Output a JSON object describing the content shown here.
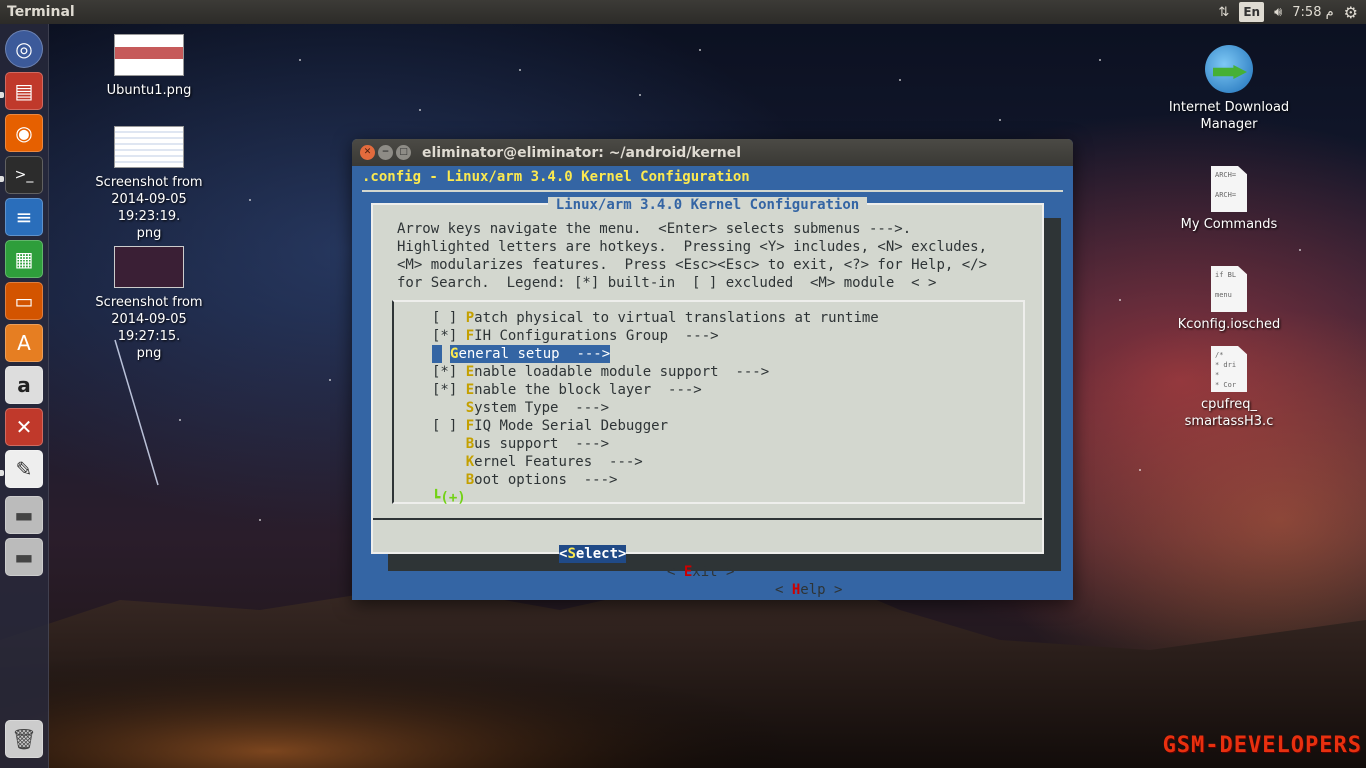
{
  "top_panel": {
    "app_title": "Terminal",
    "lang": "En",
    "clock": "7:58 م"
  },
  "launcher": {
    "items": [
      "ubuntu-dash",
      "files",
      "firefox",
      "terminal",
      "writer",
      "calc",
      "impress",
      "software-center",
      "amazon",
      "settings",
      "text-editor",
      "drive",
      "drive",
      "trash"
    ]
  },
  "desktop_icons": {
    "ubuntu1": "Ubuntu1.png",
    "shot1": "Screenshot from\n2014-09-05 19:23:19.\npng",
    "shot2": "Screenshot from\n2014-09-05 19:27:15.\npng",
    "idm": "Internet Download\nManager",
    "mycommands": "My Commands",
    "kconfig": "Kconfig.iosched",
    "cpufreq": "cpufreq_\nsmartassH3.c"
  },
  "doc_previews": {
    "mycommands": "ARCH=\n\nARCH=",
    "kconfig": "if BL\n\nmenu",
    "cpufreq": "/*\n * dri\n *\n * Cor"
  },
  "window": {
    "title": "eliminator@eliminator: ~/android/kernel"
  },
  "terminal": {
    "header": ".config - Linux/arm 3.4.0 Kernel Configuration",
    "dialog_title": "Linux/arm 3.4.0 Kernel Configuration",
    "help_text": "Arrow keys navigate the menu.  <Enter> selects submenus --->.\nHighlighted letters are hotkeys.  Pressing <Y> includes, <N> excludes,\n<M> modularizes features.  Press <Esc><Esc> to exit, <?> for Help, </>\nfor Search.  Legend: [*] built-in  [ ] excluded  <M> module  < >",
    "menu": [
      {
        "prefix": "[ ] ",
        "hotkey": "P",
        "rest": "atch physical to virtual translations at runtime"
      },
      {
        "prefix": "[*] ",
        "hotkey": "F",
        "rest": "IH Configurations Group  --->"
      },
      {
        "prefix": "    ",
        "hotkey": "G",
        "rest": "eneral setup  --->"
      },
      {
        "prefix": "[*] ",
        "hotkey": "E",
        "rest": "nable loadable module support  --->"
      },
      {
        "prefix": "[*] ",
        "hotkey": "E",
        "rest": "nable the block layer  --->"
      },
      {
        "prefix": "    ",
        "hotkey": "S",
        "rest": "ystem Type  --->"
      },
      {
        "prefix": "[ ] ",
        "hotkey": "F",
        "rest": "IQ Mode Serial Debugger"
      },
      {
        "prefix": "    ",
        "hotkey": "B",
        "rest": "us support  --->"
      },
      {
        "prefix": "    ",
        "hotkey": "K",
        "rest": "ernel Features  --->"
      },
      {
        "prefix": "    ",
        "hotkey": "B",
        "rest": "oot options  --->"
      }
    ],
    "selected_index": 2,
    "more_indicator": "┗(+)",
    "buttons": {
      "select": {
        "open": "<",
        "hotkey": "S",
        "rest": "elect>"
      },
      "exit": {
        "open": "< ",
        "hotkey": "E",
        "rest": "xit >"
      },
      "help": {
        "open": "< ",
        "hotkey": "H",
        "rest": "elp >"
      }
    }
  },
  "watermark": "GSM-DEVELOPERS"
}
